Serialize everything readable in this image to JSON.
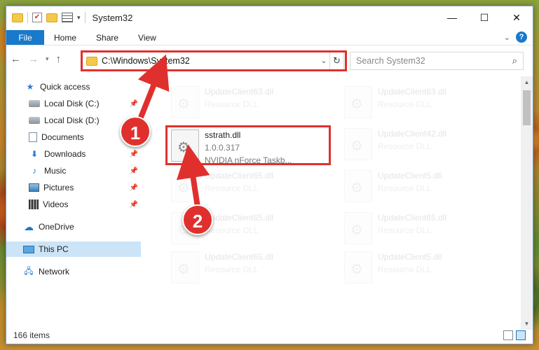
{
  "window": {
    "title": "System32",
    "buttons": {
      "minimize": "—",
      "maximize": "☐",
      "close": "✕"
    }
  },
  "ribbon": {
    "file": "File",
    "tabs": [
      "Home",
      "Share",
      "View"
    ],
    "help": "?"
  },
  "address": {
    "path": "C:\\Windows\\System32",
    "search_placeholder": "Search System32"
  },
  "nav": {
    "items": [
      {
        "label": "Quick access",
        "icon": "star-icon"
      },
      {
        "label": "Local Disk (C:)",
        "icon": "drive-icon",
        "pinned": true
      },
      {
        "label": "Local Disk (D:)",
        "icon": "drive-icon"
      },
      {
        "label": "Documents",
        "icon": "documents-icon",
        "pinned": true
      },
      {
        "label": "Downloads",
        "icon": "download-icon",
        "pinned": true
      },
      {
        "label": "Music",
        "icon": "music-icon",
        "pinned": true
      },
      {
        "label": "Pictures",
        "icon": "pictures-icon",
        "pinned": true
      },
      {
        "label": "Videos",
        "icon": "videos-icon",
        "pinned": true
      },
      {
        "label": "OneDrive",
        "icon": "cloud-icon"
      },
      {
        "label": "This PC",
        "icon": "computer-icon",
        "selected": true
      },
      {
        "label": "Network",
        "icon": "network-icon"
      }
    ]
  },
  "files": {
    "highlighted": {
      "name": "sstrath.dll",
      "version": "1.0.0.317",
      "description": "NVIDIA nForce Taskb..."
    },
    "faded": [
      {
        "name": "UpdateClient63.dll",
        "type": "Resource DLL"
      },
      {
        "name": "UpdateClient63.dll",
        "type": "Resource DLL"
      },
      {
        "name": "UpdateClient42.dll",
        "type": "Resource DLL"
      },
      {
        "name": "UpdateClient65.dll",
        "type": "Resource DLL"
      },
      {
        "name": "UpdateClient5.dll",
        "type": "Resource DLL"
      },
      {
        "name": "UpdateClient65.dll",
        "type": "Resource DLL"
      },
      {
        "name": "UpdateClient65.dll",
        "type": "Resource DLL"
      },
      {
        "name": "UpdateClient65.dll",
        "type": "Resource DLL"
      },
      {
        "name": "UpdateClient5.dll",
        "type": "Resource DLL"
      }
    ]
  },
  "status": {
    "count": "166 items"
  },
  "annotations": {
    "step1": "1",
    "step2": "2"
  },
  "colors": {
    "accent": "#1979ca",
    "highlight": "#e0302d",
    "selected": "#cce4f7"
  }
}
